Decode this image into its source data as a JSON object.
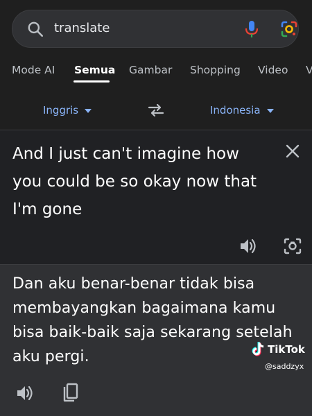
{
  "search": {
    "query": "translate"
  },
  "tabs": [
    {
      "label": "Mode AI"
    },
    {
      "label": "Semua"
    },
    {
      "label": "Gambar"
    },
    {
      "label": "Shopping"
    },
    {
      "label": "Video"
    },
    {
      "label": "V"
    }
  ],
  "active_tab": "Semua",
  "translator": {
    "source_language": "Inggris",
    "target_language": "Indonesia",
    "source_text": "And I just can't imagine how you could be so okay now that I'm gone",
    "target_text": "Dan aku benar-benar tidak bisa membayangkan bagaimana kamu bisa baik-baik saja sekarang setelah aku pergi."
  },
  "watermark": {
    "brand": "TikTok",
    "user": "@saddzyx"
  },
  "colors": {
    "background": "#1f1f1f",
    "link": "#8ab4f8",
    "target_panel": "#303134"
  },
  "icons": [
    "search-icon",
    "mic-icon",
    "google-lens-icon",
    "swap-languages-icon",
    "close-icon",
    "speaker-icon",
    "camera-icon",
    "copy-icon",
    "tiktok-logo-icon"
  ]
}
